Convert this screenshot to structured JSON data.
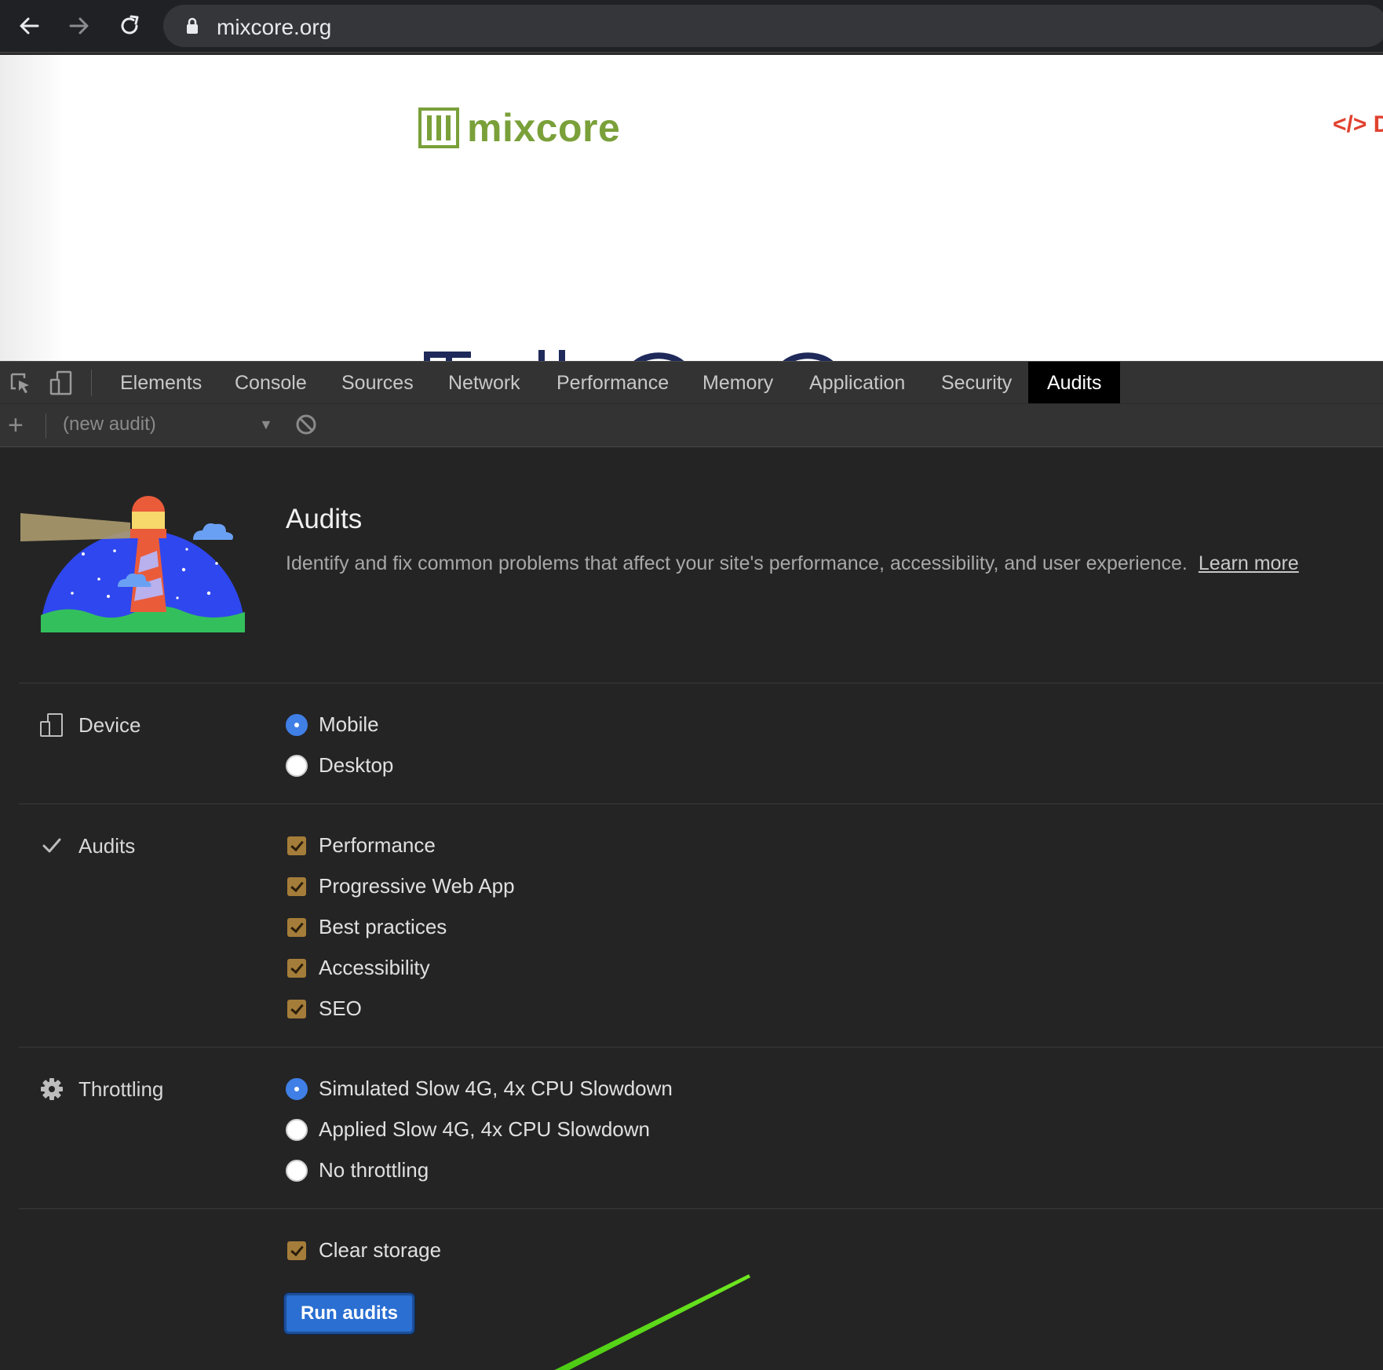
{
  "browser": {
    "url": "mixcore.org"
  },
  "page": {
    "logo_text": "mixcore",
    "top_right_mark": "</> D",
    "brand_color": "#7aa03a"
  },
  "devtools": {
    "tabs": [
      {
        "label": "Elements"
      },
      {
        "label": "Console"
      },
      {
        "label": "Sources"
      },
      {
        "label": "Network"
      },
      {
        "label": "Performance"
      },
      {
        "label": "Memory"
      },
      {
        "label": "Application"
      },
      {
        "label": "Security"
      },
      {
        "label": "Audits",
        "active": true
      }
    ],
    "toolbar": {
      "audit_select": "(new audit)"
    }
  },
  "audits_panel": {
    "title": "Audits",
    "description": "Identify and fix common problems that affect your site's performance, accessibility, and user experience.",
    "learn_more": "Learn more",
    "device": {
      "label": "Device",
      "options": [
        {
          "label": "Mobile",
          "selected": true
        },
        {
          "label": "Desktop",
          "selected": false
        }
      ]
    },
    "audits": {
      "label": "Audits",
      "options": [
        {
          "label": "Performance",
          "checked": true
        },
        {
          "label": "Progressive Web App",
          "checked": true
        },
        {
          "label": "Best practices",
          "checked": true
        },
        {
          "label": "Accessibility",
          "checked": true
        },
        {
          "label": "SEO",
          "checked": true
        }
      ]
    },
    "throttling": {
      "label": "Throttling",
      "options": [
        {
          "label": "Simulated Slow 4G, 4x CPU Slowdown",
          "selected": true
        },
        {
          "label": "Applied Slow 4G, 4x CPU Slowdown",
          "selected": false
        },
        {
          "label": "No throttling",
          "selected": false
        }
      ]
    },
    "clear_storage": {
      "label": "Clear storage",
      "checked": true
    },
    "run_button": "Run audits"
  },
  "colors": {
    "accent_blue": "#3f7fe6",
    "checkbox": "#a57d3a",
    "annotation_arrow": "#5ee01a"
  }
}
